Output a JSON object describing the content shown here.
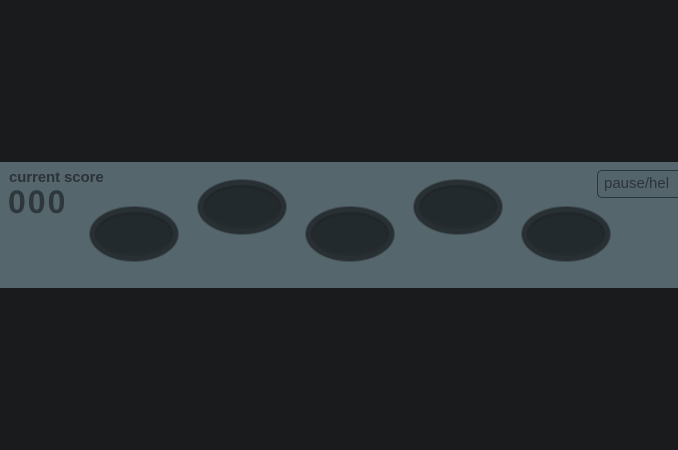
{
  "score": {
    "label": "current score",
    "value": "000"
  },
  "controls": {
    "pause_help_label": "pause/hel"
  },
  "holes": [
    {
      "id": "hole-1",
      "label": ""
    },
    {
      "id": "hole-2",
      "label": ""
    },
    {
      "id": "hole-3",
      "label": ""
    },
    {
      "id": "hole-4",
      "label": ""
    },
    {
      "id": "hole-5",
      "label": ""
    }
  ],
  "colors": {
    "background": "#1a1b1d",
    "band": "#56666d",
    "hole": "#262c30",
    "text": "#2b3337"
  }
}
